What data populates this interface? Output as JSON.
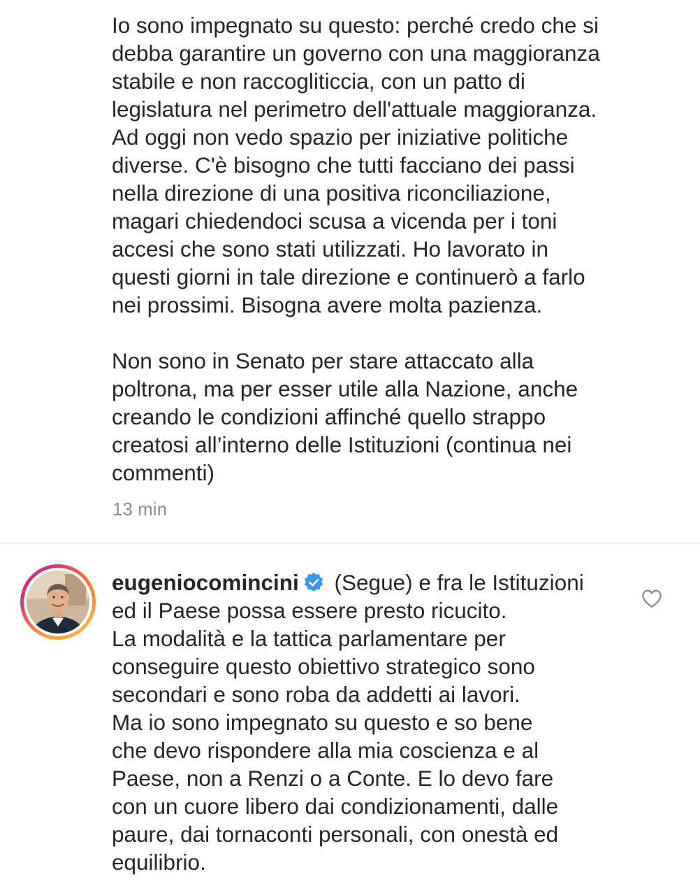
{
  "previous_comment": {
    "text": "Io sono impegnato su questo: perché credo che si\ndebba garantire un governo con una maggioranza\nstabile e non raccogliticcia, con un patto di\nlegislatura nel perimetro dell'attuale maggioranza.\nAd oggi non vedo spazio per iniziative politiche\ndiverse. C'è bisogno che tutti facciano dei passi\nnella direzione di una positiva riconciliazione,\nmagari chiedendoci scusa a vicenda per i toni\naccesi che sono stati utilizzati. Ho lavorato in\nquesti giorni in tale direzione e continuerò a farlo\nnei prossimi. Bisogna avere molta pazienza.\n\nNon sono in Senato per stare attaccato alla\npoltrona, ma per esser utile alla Nazione, anche\ncreando le condizioni affinché quello strappo\ncreatosi all’interno delle Istituzioni (continua nei\ncommenti)",
    "timestamp": "13 min"
  },
  "reply": {
    "username": "eugeniocomincini",
    "verified": true,
    "text_first": " (Segue) e fra le Istituzioni\ned il Paese possa essere presto ricucito.\nLa modalità e la tattica parlamentare per\nconseguire questo obiettivo strategico sono\nsecondari e sono roba da addetti ai lavori.\nMa io sono impegnato su questo e so bene\nche devo rispondere alla mia coscienza e al\nPaese, non a Renzi o a Conte. E lo devo fare\ncon un cuore libero dai condizionamenti, dalle\npaure, dai tornaconti personali, con onestà ed\nequilibrio."
  },
  "icons": {
    "verified_badge": "verified-check-icon",
    "like": "heart-outline-icon"
  },
  "colors": {
    "text": "#262626",
    "secondary_text": "#8e8e8e",
    "verified_blue": "#3897f0",
    "divider": "#ececec"
  }
}
